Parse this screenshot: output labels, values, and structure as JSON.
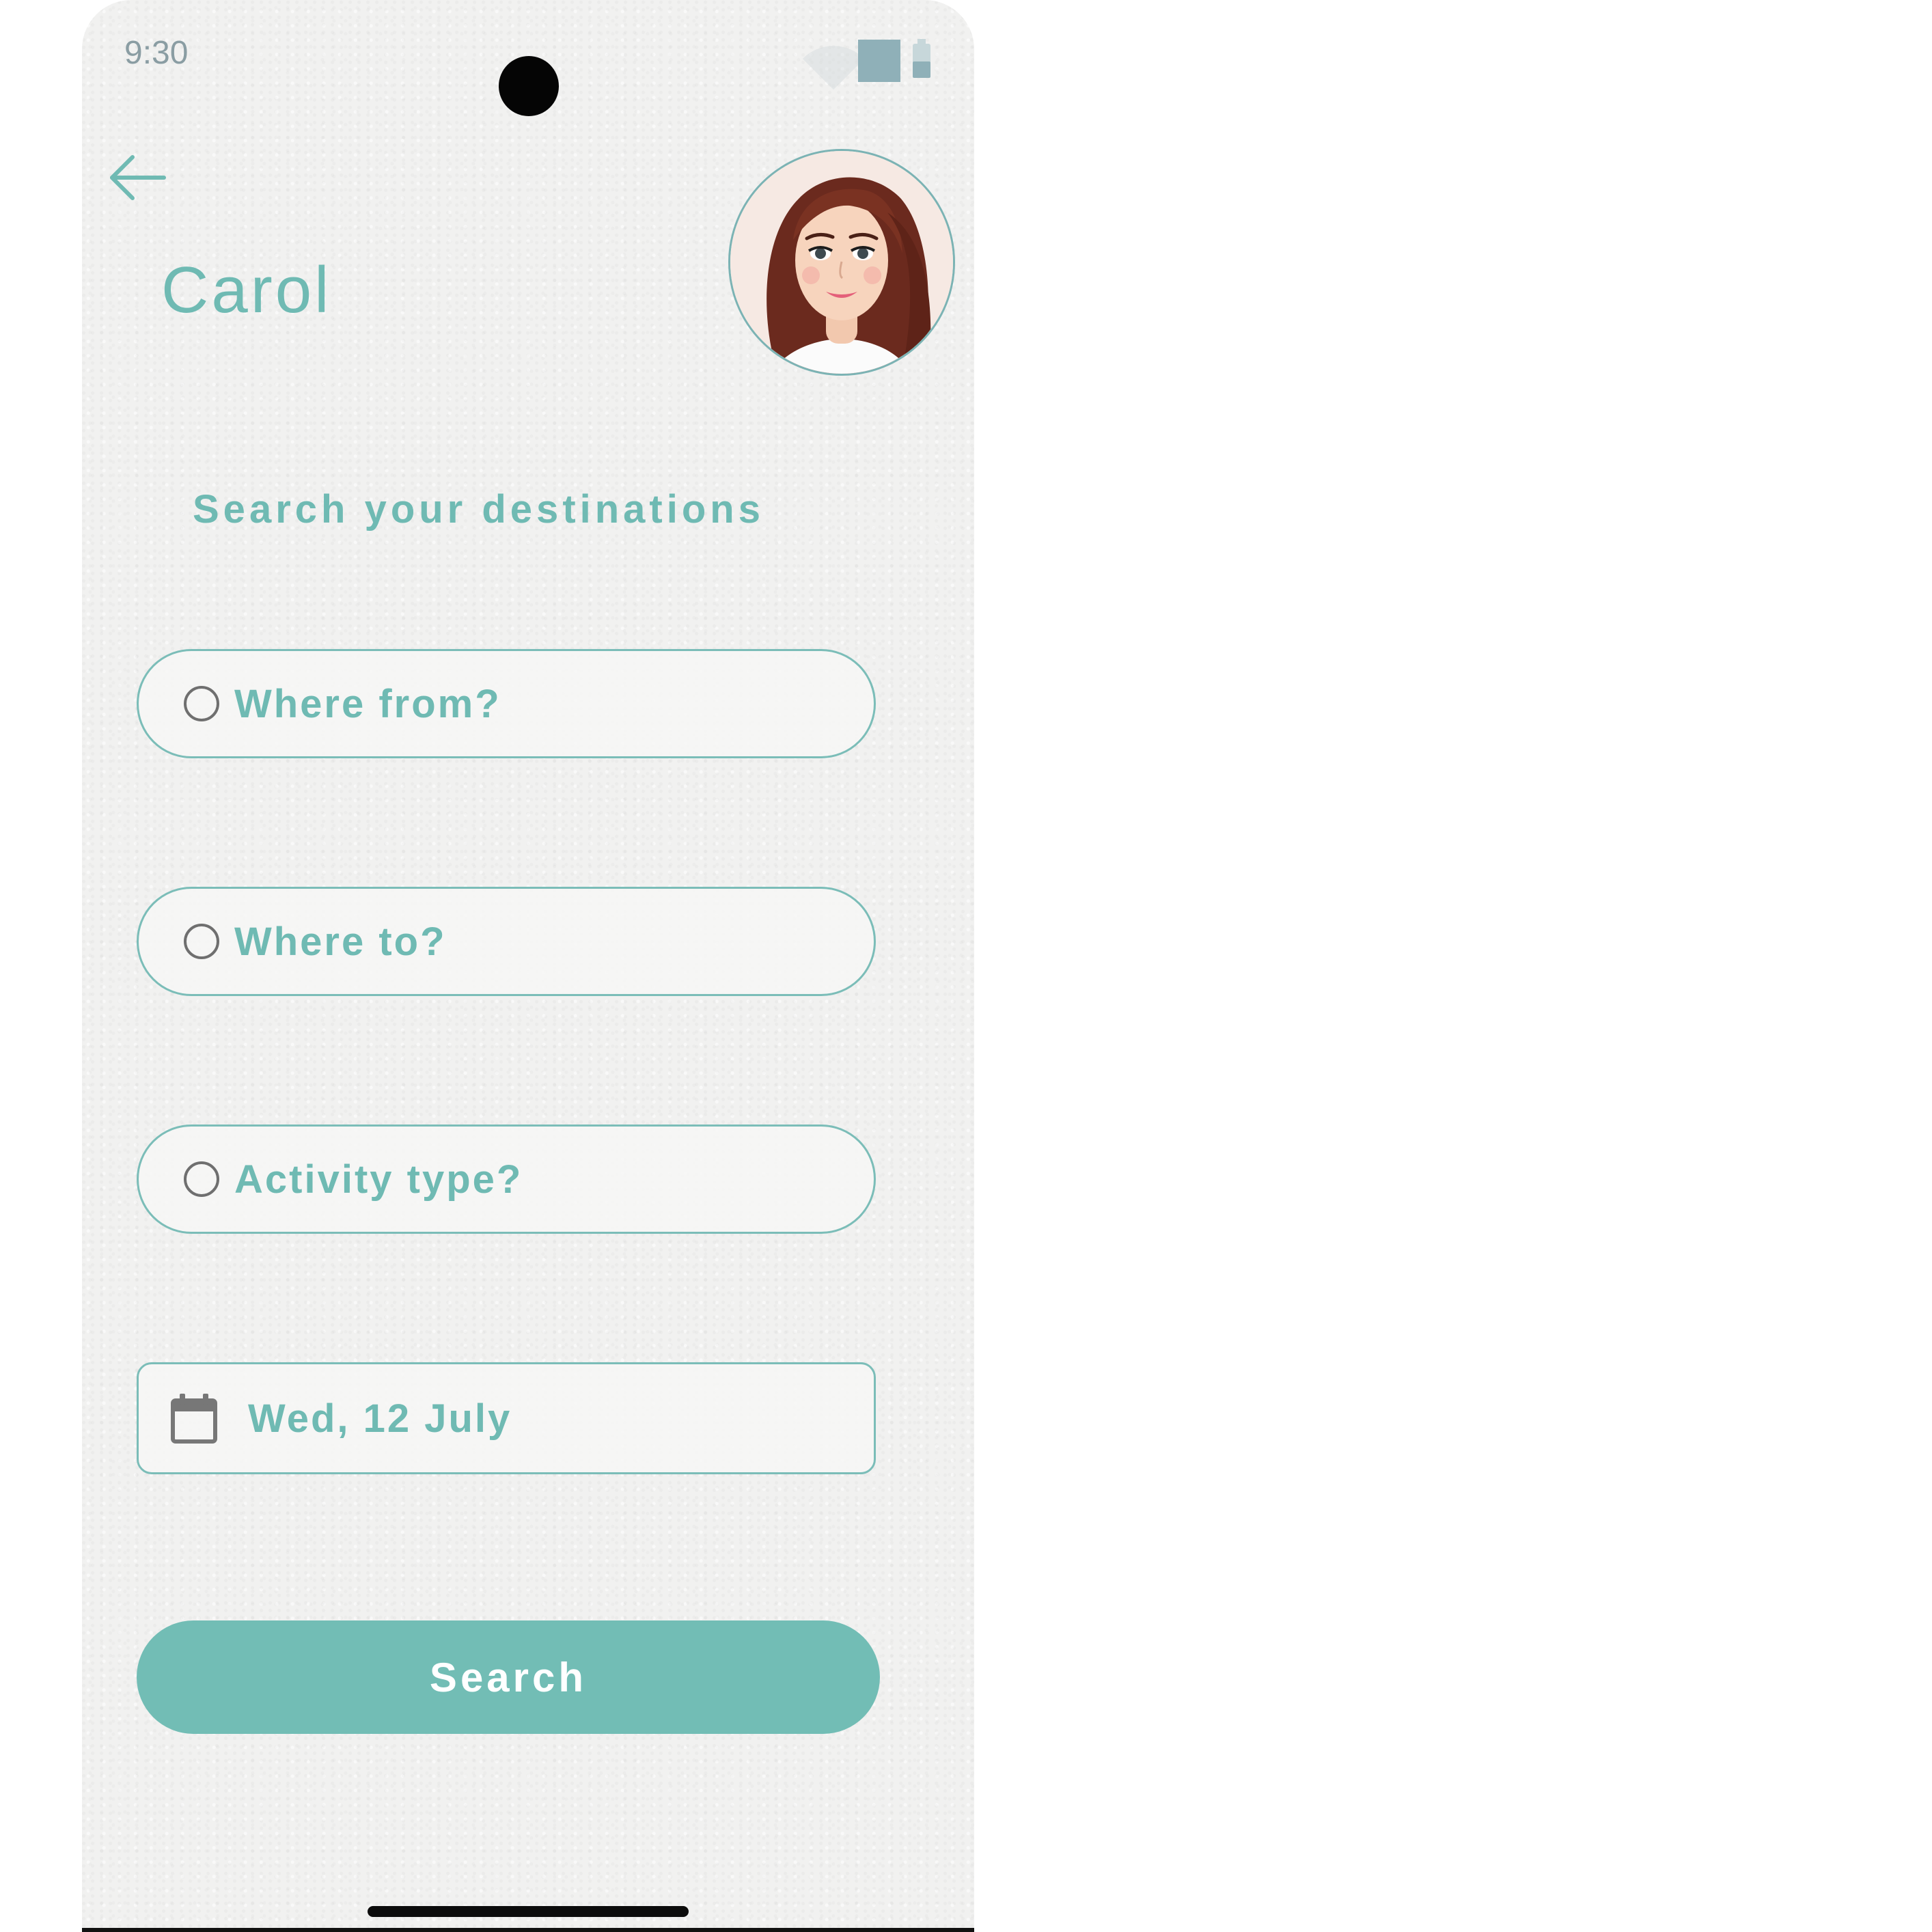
{
  "status_bar": {
    "time": "9:30",
    "icons": [
      "wifi-icon",
      "signal-icon",
      "battery-icon"
    ]
  },
  "header": {
    "back_icon": "arrow-left-icon",
    "user_name": "Carol",
    "avatar_description": "cartoon-woman-avatar"
  },
  "main": {
    "subtitle": "Search your destinations",
    "fields": [
      {
        "placeholder": "Where from?",
        "icon": "radio-circle-icon"
      },
      {
        "placeholder": "Where to?",
        "icon": "radio-circle-icon"
      },
      {
        "placeholder": "Activity type?",
        "icon": "radio-circle-icon"
      }
    ],
    "date": {
      "value": "Wed, 12 July",
      "icon": "calendar-icon"
    },
    "search_label": "Search"
  },
  "colors": {
    "accent": "#72bdb5",
    "border": "#7bbdb8",
    "background": "#f1f1f0",
    "muted_icon": "#8fb0b8"
  }
}
